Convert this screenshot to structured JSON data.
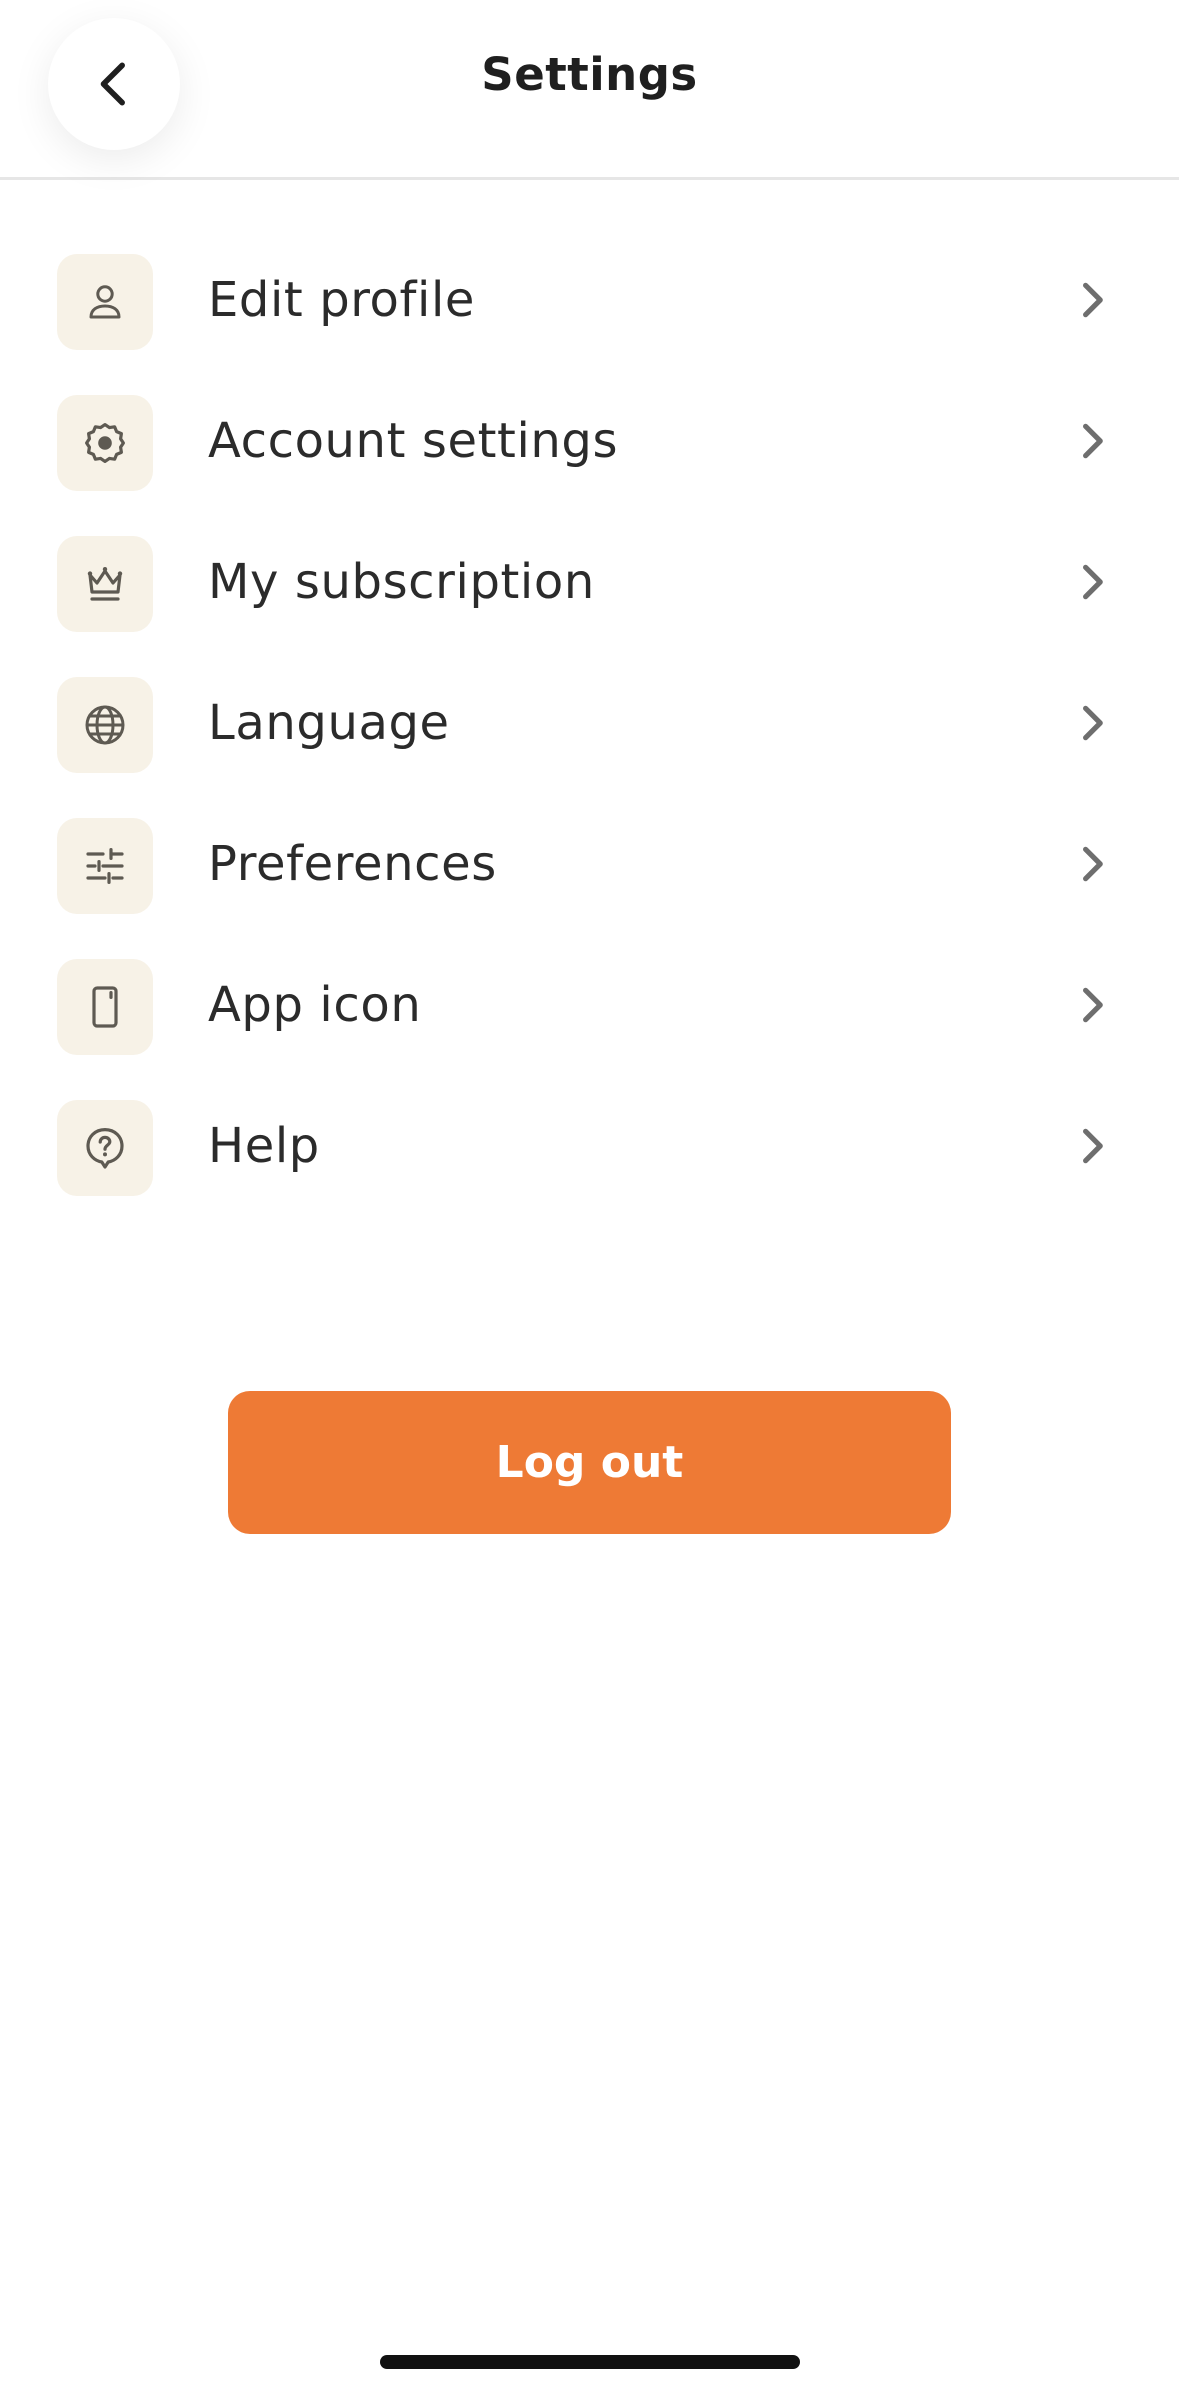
{
  "header": {
    "title": "Settings",
    "back_icon": "chevron-left-icon"
  },
  "settings": {
    "items": [
      {
        "label": "Edit profile",
        "icon": "person-icon"
      },
      {
        "label": "Account settings",
        "icon": "gear-icon"
      },
      {
        "label": "My subscription",
        "icon": "crown-icon"
      },
      {
        "label": "Language",
        "icon": "globe-icon"
      },
      {
        "label": "Preferences",
        "icon": "sliders-icon"
      },
      {
        "label": "App icon",
        "icon": "phone-icon"
      },
      {
        "label": "Help",
        "icon": "help-bubble-icon"
      }
    ]
  },
  "logout": {
    "label": "Log out"
  },
  "colors": {
    "accent": "#ee7a35",
    "icon_tile": "#f7f2e7",
    "icon_stroke": "#5e5a52",
    "chevron": "#6e6e6e",
    "divider": "#e6e6e6"
  }
}
